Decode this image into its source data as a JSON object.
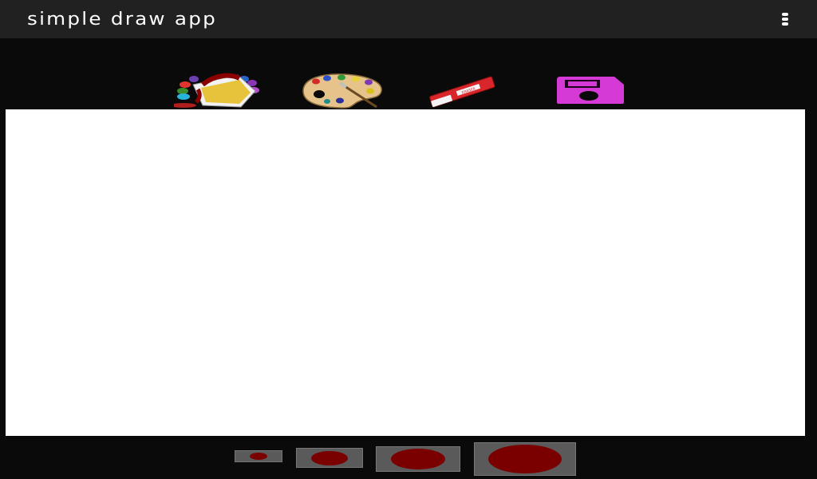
{
  "app_bar": {
    "title": "simple draw app",
    "overflow_icon": "overflow-menu-icon"
  },
  "toolbar": {
    "tools": [
      {
        "id": "paint-bucket",
        "icon": "paint-bucket-icon"
      },
      {
        "id": "palette",
        "icon": "palette-icon"
      },
      {
        "id": "eraser",
        "icon": "eraser-icon",
        "text": "ERASER"
      },
      {
        "id": "save",
        "icon": "save-icon"
      }
    ]
  },
  "canvas": {
    "background": "#ffffff"
  },
  "brush_sizes": [
    {
      "id": "small",
      "icon": "brush-small-icon"
    },
    {
      "id": "medium",
      "icon": "brush-medium-icon"
    },
    {
      "id": "large",
      "icon": "brush-large-icon"
    },
    {
      "id": "xlarge",
      "icon": "brush-xlarge-icon"
    }
  ],
  "colors": {
    "app_bar": "#212121",
    "background": "#0a0a0a",
    "brush": "#7a0000",
    "save_icon": "#d63ad6",
    "eraser": "#d8262b"
  }
}
